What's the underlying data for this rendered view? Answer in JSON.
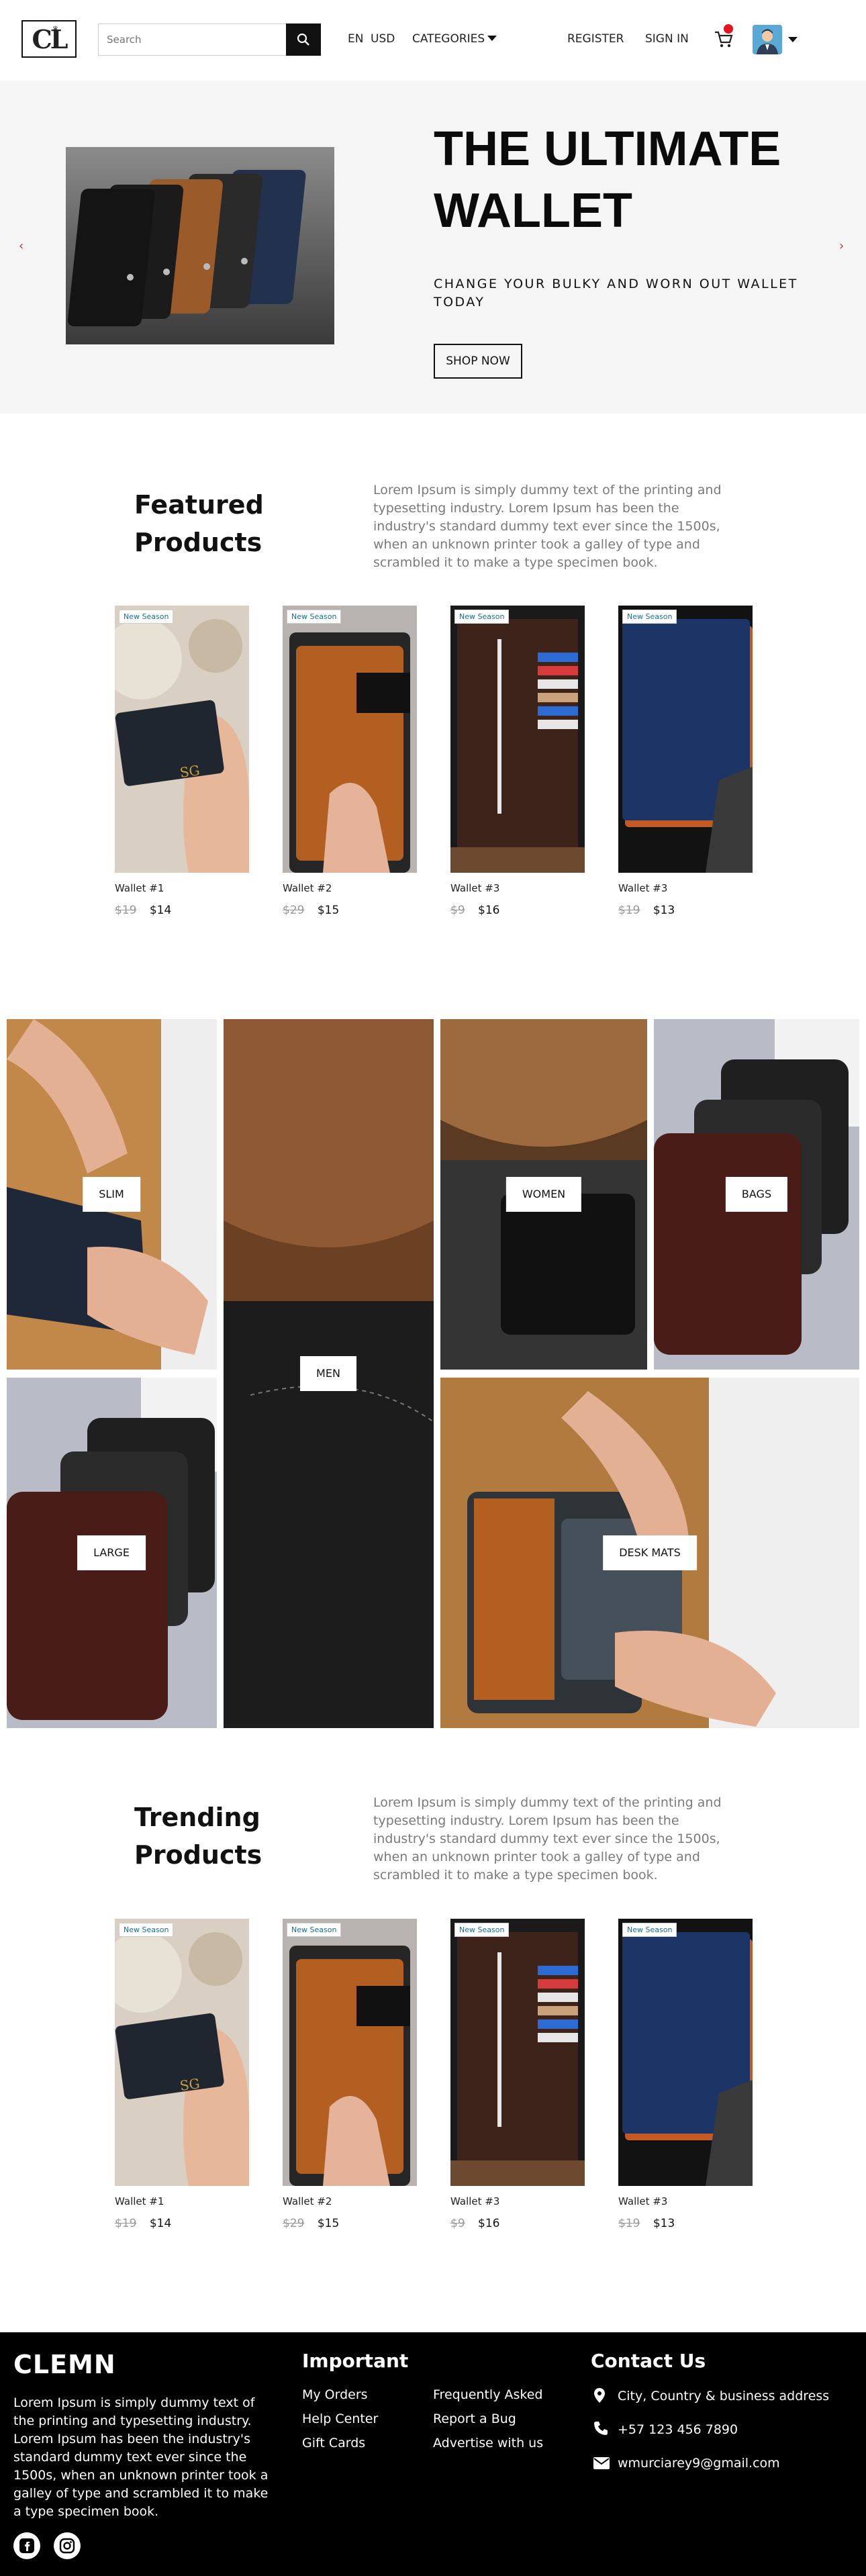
{
  "header": {
    "logo": "CL",
    "search_placeholder": "Search",
    "language": "EN",
    "currency": "USD",
    "categories_label": "CATEGORIES",
    "register_label": "REGISTER",
    "signin_label": "SIGN IN"
  },
  "hero": {
    "title_line1": "THE ULTIMATE",
    "title_line2": "WALLET",
    "subtitle": "CHANGE YOUR BULKY AND WORN OUT WALLET TODAY",
    "button_label": "SHOP NOW",
    "prev_arrow": "‹",
    "next_arrow": "›"
  },
  "featured": {
    "title_line1": "Featured",
    "title_line2": "Products",
    "description": "Lorem Ipsum is simply dummy text of the printing and typesetting industry. Lorem Ipsum has been the industry's standard dummy text ever since the 1500s, when an unknown printer took a galley of type and scrambled it to make a type specimen book.",
    "products": [
      {
        "badge": "New Season",
        "name": "Wallet #1",
        "old_price": "$19",
        "price": "$14"
      },
      {
        "badge": "New Season",
        "name": "Wallet #2",
        "old_price": "$29",
        "price": "$15"
      },
      {
        "badge": "New Season",
        "name": "Wallet #3",
        "old_price": "$9",
        "price": "$16"
      },
      {
        "badge": "New Season",
        "name": "Wallet #3",
        "old_price": "$19",
        "price": "$13"
      }
    ]
  },
  "categories": [
    {
      "label": "SLIM"
    },
    {
      "label": "MEN"
    },
    {
      "label": "WOMEN"
    },
    {
      "label": "BAGS"
    },
    {
      "label": "LARGE"
    },
    {
      "label": "DESK MATS"
    }
  ],
  "trending": {
    "title_line1": "Trending",
    "title_line2": "Products",
    "description": "Lorem Ipsum is simply dummy text of the printing and typesetting industry. Lorem Ipsum has been the industry's standard dummy text ever since the 1500s, when an unknown printer took a galley of type and scrambled it to make a type specimen book.",
    "products": [
      {
        "badge": "New Season",
        "name": "Wallet #1",
        "old_price": "$19",
        "price": "$14"
      },
      {
        "badge": "New Season",
        "name": "Wallet #2",
        "old_price": "$29",
        "price": "$15"
      },
      {
        "badge": "New Season",
        "name": "Wallet #3",
        "old_price": "$9",
        "price": "$16"
      },
      {
        "badge": "New Season",
        "name": "Wallet #3",
        "old_price": "$19",
        "price": "$13"
      }
    ]
  },
  "footer": {
    "brand": "CLEMN",
    "about": "Lorem Ipsum is simply dummy text of the printing and typesetting industry. Lorem Ipsum has been the industry's standard dummy text ever since the 1500s, when an unknown printer took a galley of type and scrambled it to make a type specimen book.",
    "important_title": "Important",
    "links_col1": [
      "My Orders",
      "Help Center",
      "Gift Cards"
    ],
    "links_col2": [
      "Frequently Asked",
      "Report a Bug",
      "Advertise with us"
    ],
    "contact_title": "Contact Us",
    "address": "City, Country & business address",
    "phone": "+57 123 456 7890",
    "email": "wmurciarey9@gmail.com"
  },
  "colors": {
    "accent_dark": "#000000",
    "cart_badge": "#e5131d",
    "badge_text": "#1a6f8a"
  }
}
